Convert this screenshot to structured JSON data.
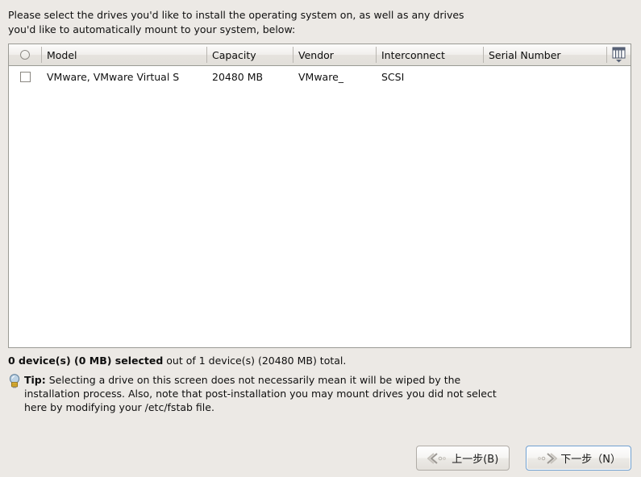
{
  "intro": {
    "text": "Please select the drives you'd like to install the operating system on, as well as any drives\nyou'd like to automatically mount to your system, below:"
  },
  "table": {
    "select_all_icon": "radio-unchecked-icon",
    "columns_icon": "column-chooser-icon",
    "columns": [
      {
        "key": "model",
        "label": "Model"
      },
      {
        "key": "capacity",
        "label": "Capacity"
      },
      {
        "key": "vendor",
        "label": "Vendor"
      },
      {
        "key": "interconnect",
        "label": "Interconnect"
      },
      {
        "key": "serial",
        "label": "Serial Number"
      }
    ],
    "rows": [
      {
        "checked": false,
        "model": "VMware, VMware Virtual S",
        "capacity": "20480 MB",
        "vendor": "VMware_",
        "interconnect": "SCSI",
        "serial": ""
      }
    ]
  },
  "status": {
    "bold": "0 device(s) (0 MB) selected",
    "rest": " out of 1 device(s) (20480 MB) total."
  },
  "tip": {
    "icon": "lightbulb-icon",
    "label": "Tip:",
    "body": " Selecting a drive on this screen does not necessarily mean it will be wiped by the installation process.  Also, note that post-installation you may mount drives you did not select here by modifying your /etc/fstab file."
  },
  "buttons": {
    "back": {
      "label": "上一步(B)",
      "icon": "arrow-left-icon"
    },
    "next": {
      "label": "下一步（N）",
      "icon": "arrow-right-icon"
    }
  },
  "colors": {
    "background": "#ece9e5",
    "table_border": "#9a9a94",
    "table_body": "#ffffff",
    "focus_border": "#6f9fcf",
    "text": "#0f0f0f"
  }
}
